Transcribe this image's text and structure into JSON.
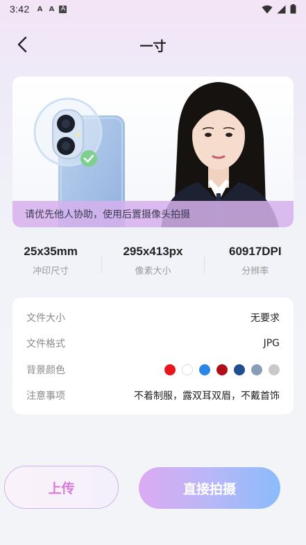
{
  "status_bar": {
    "time": "3:42",
    "left_icons": [
      "A",
      "A",
      "A"
    ]
  },
  "header": {
    "title": "一寸",
    "back_icon": "chevron-left-icon"
  },
  "hero": {
    "hint": "请优先他人协助，使用后置摄像头拍摄"
  },
  "specs": [
    {
      "value": "25x35mm",
      "label": "冲印尺寸"
    },
    {
      "value": "295x413px",
      "label": "像素大小"
    },
    {
      "value": "60917DPI",
      "label": "分辨率"
    }
  ],
  "info": {
    "file_size_label": "文件大小",
    "file_size_value": "无要求",
    "file_format_label": "文件格式",
    "file_format_value": "JPG",
    "bg_color_label": "背景颜色",
    "bg_colors": [
      "#e8161c",
      "#ffffff",
      "#2a86e6",
      "#b00d1b",
      "#1f4f8f",
      "#8a9db8",
      "#c9c9c9"
    ],
    "notes_label": "注意事项",
    "notes_value": "不着制服，露双耳双眉，不戴首饰"
  },
  "buttons": {
    "upload": "上传",
    "shoot": "直接拍摄"
  }
}
